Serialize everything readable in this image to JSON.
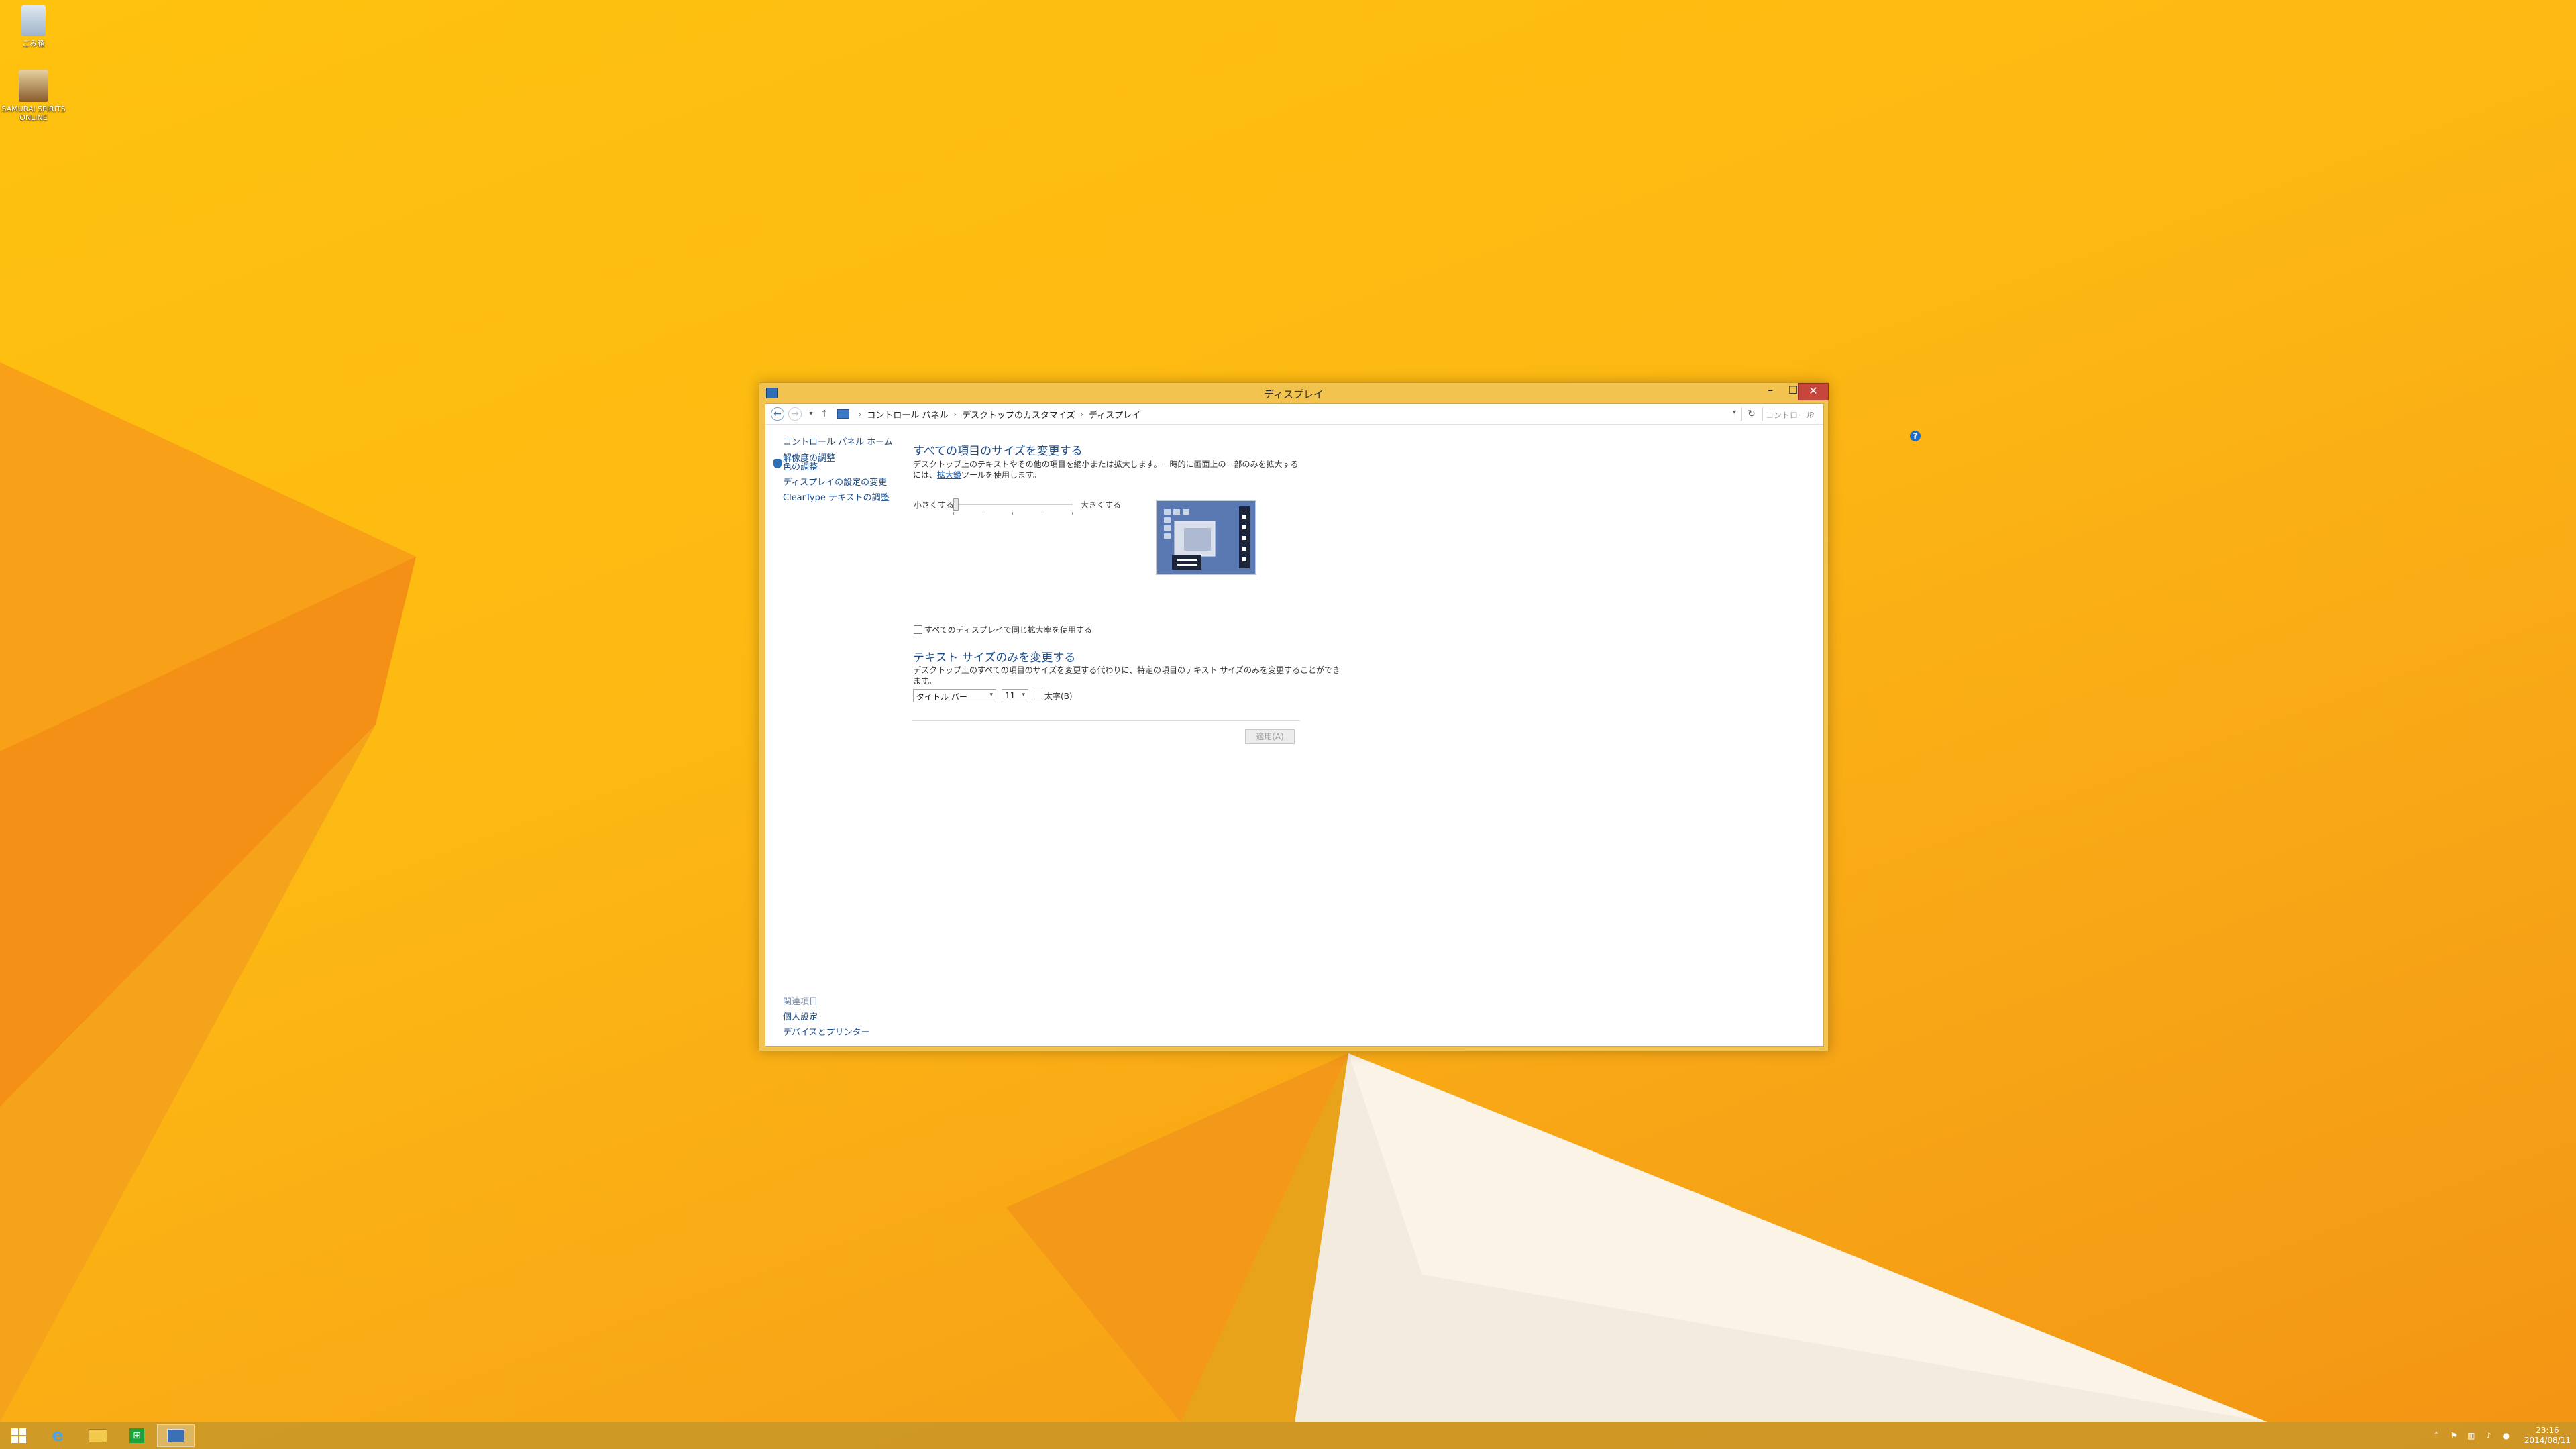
{
  "desktop": {
    "icons": [
      {
        "label": "ごみ箱"
      },
      {
        "label": "SAMURAI SPIRITS ONLINE"
      }
    ],
    "colors": {
      "base": "#fdb913",
      "accent": "#f29013",
      "light": "#f5eddf"
    }
  },
  "window": {
    "title": "ディスプレイ",
    "controls": {
      "minimize": "–",
      "maximize": "☐",
      "close": "✕"
    },
    "breadcrumb": [
      "コントロール パネル",
      "デスクトップのカスタマイズ",
      "ディスプレイ"
    ],
    "search_placeholder": "コントロール パネルの検索",
    "left_pane": {
      "home": "コントロール パネル ホーム",
      "links": [
        "解像度の調整",
        "色の調整",
        "ディスプレイの設定の変更",
        "ClearType テキストの調整"
      ],
      "see_also_title": "関連項目",
      "see_also": [
        "個人設定",
        "デバイスとプリンター"
      ]
    },
    "main": {
      "heading1": "すべての項目のサイズを変更する",
      "desc1_a": "デスクトップ上のテキストやその他の項目を縮小または拡大します。一時的に画面上の一部のみを拡大するには、",
      "desc1_link": "拡大鏡",
      "desc1_b": "ツールを使用します。",
      "slider_smaller": "小さくする",
      "slider_larger": "大きくする",
      "slider_value_fraction": 0.0,
      "checkbox_same_scale": "すべてのディスプレイで同じ拡大率を使用する",
      "heading2": "テキスト サイズのみを変更する",
      "desc2": "デスクトップ上のすべての項目のサイズを変更する代わりに、特定の項目のテキスト サイズのみを変更することができます。",
      "item_select": "タイトル バー",
      "size_select": "11",
      "bold_label": "太字(B)",
      "apply": "適用(A)"
    }
  },
  "taskbar": {
    "clock_time": "23:16",
    "clock_date": "2014/08/11"
  }
}
